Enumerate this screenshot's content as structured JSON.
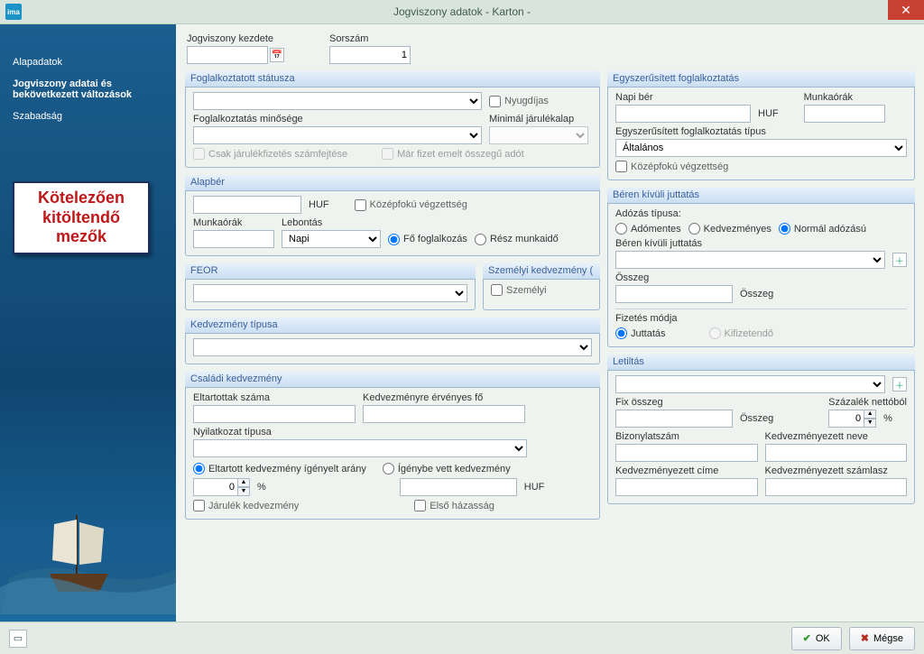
{
  "window": {
    "title": "Jogviszony adatok - Karton  -",
    "appicon_text": "ima"
  },
  "sidebar": {
    "items": [
      {
        "label": "Alapadatok"
      },
      {
        "label": "Jogviszony adatai és bekövetkezett változások"
      },
      {
        "label": "Szabadság"
      }
    ]
  },
  "callout": {
    "line1": "Kötelezően",
    "line2": "kitöltendő",
    "line3": "mezők"
  },
  "top": {
    "start_label": "Jogviszony kezdete",
    "start_value": "",
    "sorszam_label": "Sorszám",
    "sorszam_value": "1"
  },
  "fog_stat": {
    "title": "Foglalkoztatott státusza",
    "nyugdijas": "Nyugdíjas",
    "minoseg_label": "Foglalkoztatás minősége",
    "min_jarulek_label": "Minimál járulékalap",
    "csak_jarulek": "Csak járulékfizetés számfejtése",
    "mar_fizet": "Már fizet emelt összegű adót"
  },
  "alap": {
    "title": "Alapbér",
    "huf": "HUF",
    "kozepfoku": "Középfokú végzettség",
    "munkaorak": "Munkaórák",
    "lebontas": "Lebontás",
    "lebontas_value": "Napi",
    "fo": "Fő foglalkozás",
    "resz": "Rész munkaidő"
  },
  "feor": {
    "title": "FEOR"
  },
  "szemelyi": {
    "title": "Személyi kedvezmény (",
    "chk": "Személyi"
  },
  "kedv_tipus": {
    "title": "Kedvezmény típusa"
  },
  "csaladi": {
    "title": "Családi kedvezmény",
    "eltartottak": "Eltartottak száma",
    "kedv_fo": "Kedvezményre érvényes fő",
    "nyil_tipus": "Nyilatkozat típusa",
    "elt_igeny": "Eltartott kedvezmény ígényelt arány",
    "igeny_vett": "Ígénybe vett kedvezmény",
    "percent_value": "0",
    "percent_sign": "%",
    "huf": "HUF",
    "jarulek_kedv": "Járulék kedvezmény",
    "elso_haz": "Első házasság"
  },
  "egysz": {
    "title": "Egyszerűsített foglalkoztatás",
    "napi_ber": "Napi bér",
    "huf": "HUF",
    "munkaorak": "Munkaórák",
    "tipus_label": "Egyszerűsített foglalkoztatás típus",
    "tipus_value": "Általános",
    "kozepfoku": "Középfokú végzettség"
  },
  "beren": {
    "title": "Béren kívüli juttatás",
    "adozas_label": "Adózás típusa:",
    "adomentes": "Adómentes",
    "kedvezmenyes": "Kedvezményes",
    "normal": "Normál adózású",
    "juttatas_label": "Béren kívüli juttatás",
    "osszeg_label": "Összeg",
    "osszeg_unit": "Összeg",
    "fizetes_label": "Fizetés módja",
    "juttatas_opt": "Juttatás",
    "kifizetendo_opt": "Kifizetendő"
  },
  "letiltas": {
    "title": "Letiltás",
    "fix": "Fix összeg",
    "osszeg": "Összeg",
    "szazalek": "Százalék nettóból",
    "szazalek_value": "0",
    "percent_sign": "%",
    "bizonylat": "Bizonylatszám",
    "kedv_neve": "Kedvezményezett neve",
    "kedv_cime": "Kedvezményezett címe",
    "kedv_szamla": "Kedvezményezett számlasz"
  },
  "buttons": {
    "ok": "OK",
    "megse": "Mégse"
  }
}
